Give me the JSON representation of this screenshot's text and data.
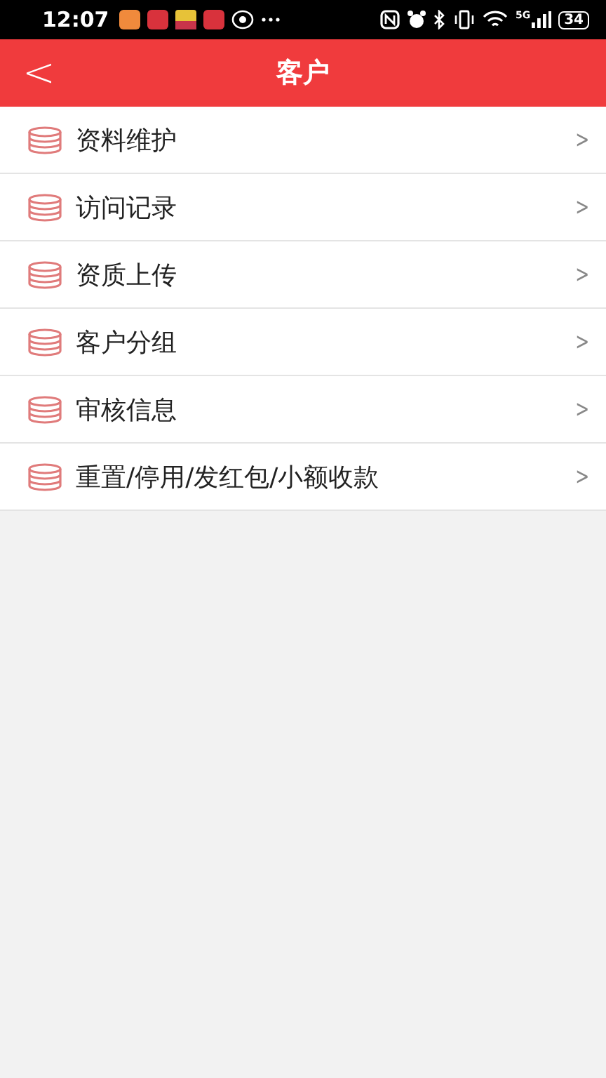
{
  "status_bar": {
    "time": "12:07",
    "network": "5G",
    "battery": "34"
  },
  "header": {
    "back": "<",
    "title": "客户"
  },
  "menu": [
    {
      "label": "资料维护",
      "chevron": ">"
    },
    {
      "label": "访问记录",
      "chevron": ">"
    },
    {
      "label": "资质上传",
      "chevron": ">"
    },
    {
      "label": "客户分组",
      "chevron": ">"
    },
    {
      "label": "审核信息",
      "chevron": ">"
    },
    {
      "label": "重置/停用/发红包/小额收款",
      "chevron": ">"
    }
  ]
}
